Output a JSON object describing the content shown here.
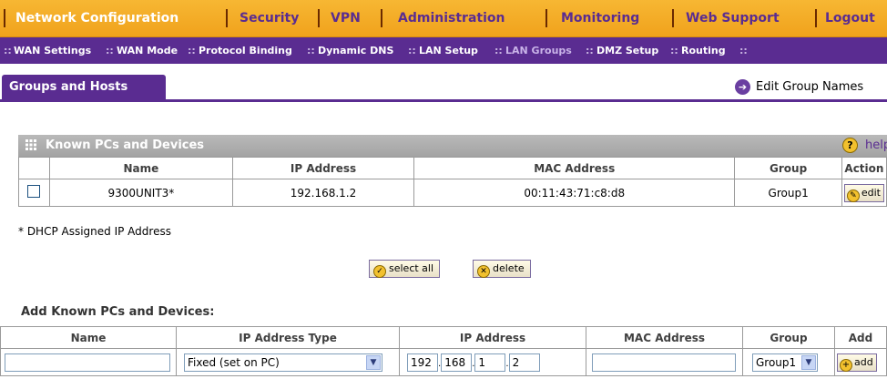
{
  "top_nav": {
    "items": [
      "Network Configuration",
      "Security",
      "VPN",
      "Administration",
      "Monitoring",
      "Web Support",
      "Logout"
    ]
  },
  "sub_nav": {
    "items": [
      "WAN Settings",
      "WAN Mode",
      "Protocol Binding",
      "Dynamic DNS",
      "LAN Setup",
      "LAN Groups",
      "DMZ Setup",
      "Routing"
    ],
    "active": "LAN Groups"
  },
  "tab": {
    "label": "Groups and Hosts"
  },
  "edit_group_names": "Edit Group Names",
  "known_section": {
    "title": "Known PCs and Devices",
    "help": "help",
    "columns": [
      "Name",
      "IP Address",
      "MAC Address",
      "Group",
      "Action"
    ],
    "rows": [
      {
        "name": "9300UNIT3*",
        "ip": "192.168.1.2",
        "mac": "00:11:43:71:c8:d8",
        "group": "Group1",
        "action": "edit"
      }
    ]
  },
  "dhcp_note": "* DHCP Assigned IP Address",
  "buttons": {
    "select_all": "select all",
    "delete": "delete",
    "add": "add"
  },
  "add_section": {
    "title": "Add Known PCs and Devices:",
    "columns": [
      "Name",
      "IP Address Type",
      "IP Address",
      "MAC Address",
      "Group",
      "Add"
    ],
    "ip_type_value": "Fixed (set on PC)",
    "ip_octets": [
      "192",
      "168",
      "1",
      "2"
    ],
    "group_value": "Group1",
    "name_value": "",
    "mac_value": ""
  },
  "colors": {
    "orange": "#f0a21c",
    "purple": "#5a2c91",
    "gray": "#a3a3a3"
  }
}
